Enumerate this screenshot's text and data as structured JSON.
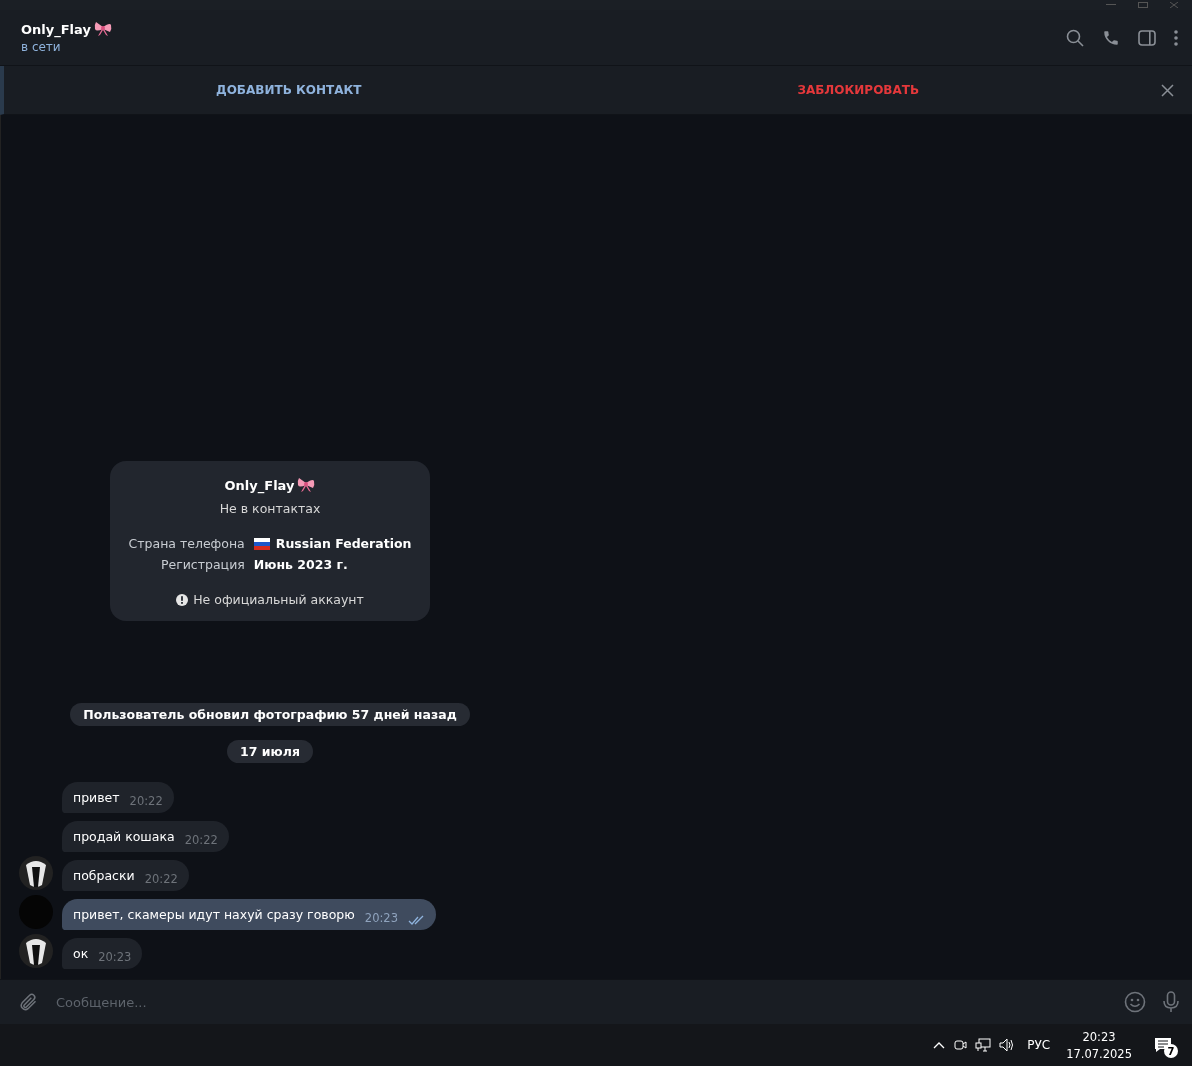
{
  "header": {
    "title": "Only_Flay",
    "status": "в сети"
  },
  "action_bar": {
    "add_contact": "ДОБАВИТЬ КОНТАКТ",
    "block": "ЗАБЛОКИРОВАТЬ"
  },
  "info_card": {
    "name": "Only_Flay",
    "subtitle": "Не в контактах",
    "rows": [
      {
        "label": "Страна телефона",
        "value": "Russian Federation",
        "flag": true
      },
      {
        "label": "Регистрация",
        "value": "Июнь 2023 г.",
        "flag": false
      }
    ],
    "note": "Не официальный аккаунт"
  },
  "service_messages": [
    "Пользователь обновил фотографию 57 дней назад",
    "17 июля"
  ],
  "messages": [
    {
      "kind": "incoming",
      "text": "привет",
      "time": "20:22",
      "avatar": false
    },
    {
      "kind": "incoming",
      "text": "продай кошака",
      "time": "20:22",
      "avatar": false
    },
    {
      "kind": "incoming",
      "text": "побраски",
      "time": "20:22",
      "avatar": true
    },
    {
      "kind": "outgoing",
      "text": "привет, скамеры идут нахуй сразу говорю",
      "time": "20:23",
      "avatar": true,
      "read": true
    },
    {
      "kind": "incoming",
      "text": "ок",
      "time": "20:23",
      "avatar": true
    }
  ],
  "composer": {
    "placeholder": "Сообщение..."
  },
  "taskbar": {
    "language": "РУС",
    "time": "20:23",
    "date": "17.07.2025",
    "notifications": "7"
  }
}
